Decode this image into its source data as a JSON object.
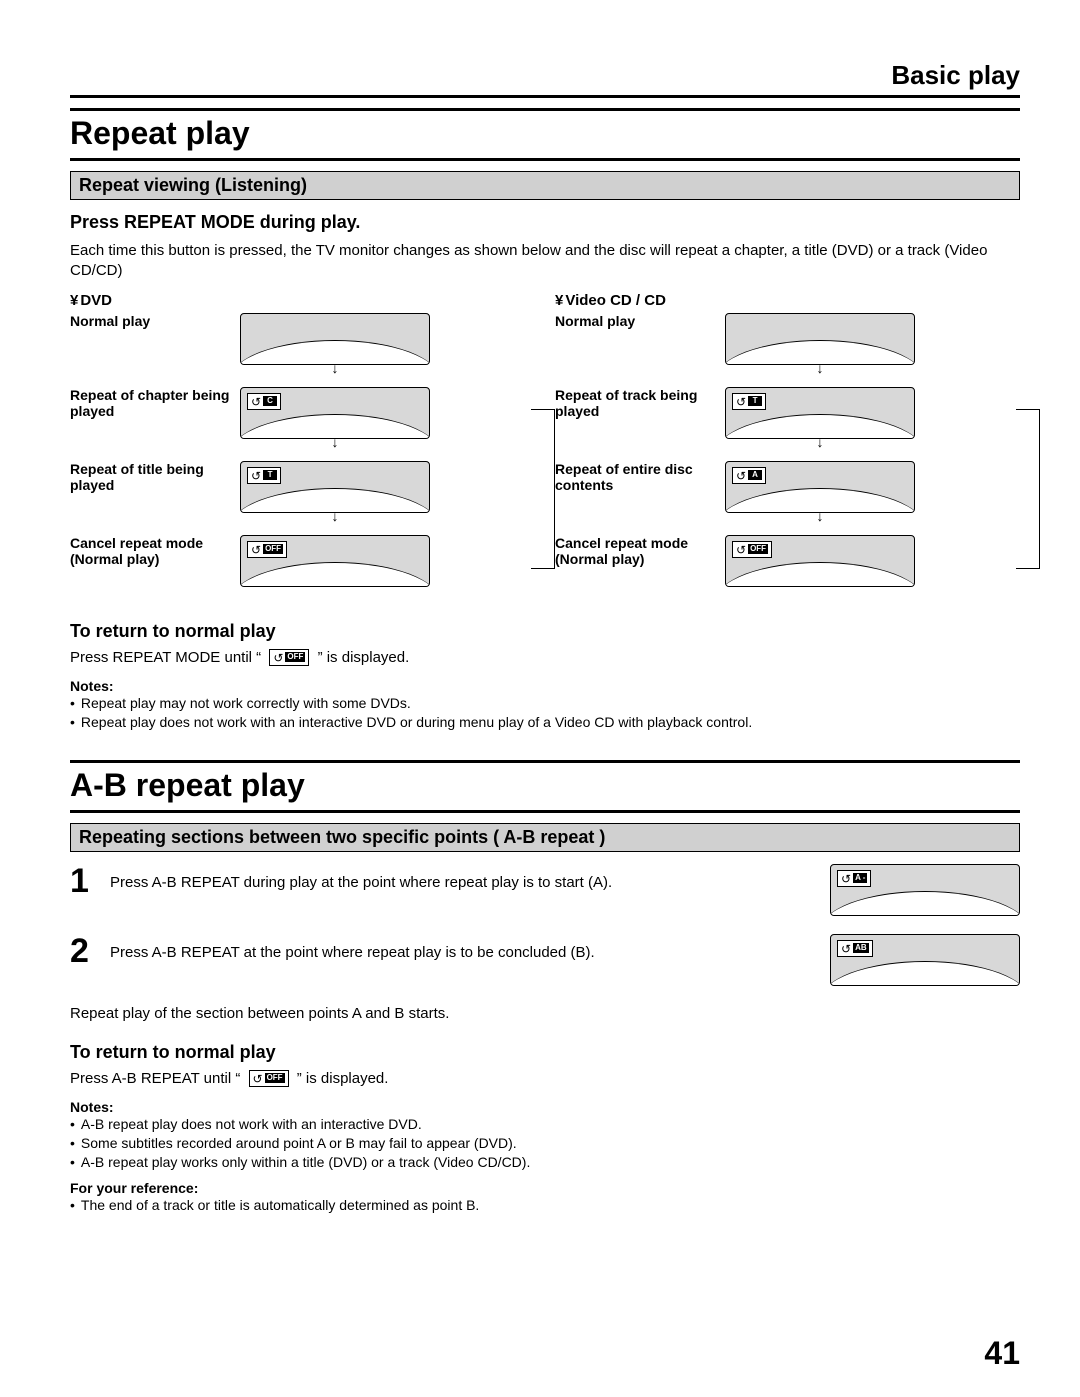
{
  "topTitle": "Basic play",
  "section1": {
    "title": "Repeat play",
    "subBar": "Repeat viewing (Listening)",
    "instruction": "Press REPEAT MODE during play.",
    "desc": "Each time this button is pressed, the TV monitor changes as shown below and the disc will repeat a chapter, a title (DVD) or a track (Video CD/CD)",
    "dvd": {
      "head": "DVD",
      "states": [
        {
          "label": "Normal play",
          "badge": null
        },
        {
          "label": "Repeat of chapter being played",
          "badge": "C"
        },
        {
          "label": "Repeat of title being played",
          "badge": "T"
        },
        {
          "label": "Cancel repeat mode (Normal play)",
          "badge": "OFF"
        }
      ]
    },
    "vcd": {
      "head": "Video CD / CD",
      "states": [
        {
          "label": "Normal play",
          "badge": null
        },
        {
          "label": "Repeat of track being played",
          "badge": "T"
        },
        {
          "label": "Repeat of entire disc contents",
          "badge": "A"
        },
        {
          "label": "Cancel repeat mode (Normal play)",
          "badge": "OFF"
        }
      ]
    },
    "returnHead": "To return to normal play",
    "returnTextA": "Press REPEAT MODE until “ ",
    "returnBadge": "OFF",
    "returnTextB": " ” is displayed.",
    "notesHead": "Notes:",
    "notes": [
      "Repeat play may not work correctly with some DVDs.",
      "Repeat play does not work with an interactive DVD or during menu play of a Video CD with playback control."
    ]
  },
  "section2": {
    "title": "A-B repeat play",
    "subBar": "Repeating sections between two specific points ( A-B repeat )",
    "steps": [
      {
        "num": "1",
        "text": "Press A-B REPEAT during play at the point where repeat play is to start (A).",
        "badge": "A -"
      },
      {
        "num": "2",
        "text": "Press A-B REPEAT at the point where repeat play is to be concluded (B).",
        "badge": "AB"
      }
    ],
    "afterSteps": "Repeat play of the section between points A and B starts.",
    "returnHead": "To return to normal play",
    "returnTextA": "Press A-B REPEAT until “ ",
    "returnBadge": "OFF",
    "returnTextB": " ” is displayed.",
    "notesHead": "Notes:",
    "notes": [
      "A-B repeat play does not work with an interactive DVD.",
      "Some subtitles recorded around point A or B may fail to appear (DVD).",
      "A-B repeat play works only within a title (DVD) or a track (Video CD/CD)."
    ],
    "refHead": "For your reference:",
    "ref": "The end of a track or title is automatically determined as point B."
  },
  "pageNumber": "41"
}
